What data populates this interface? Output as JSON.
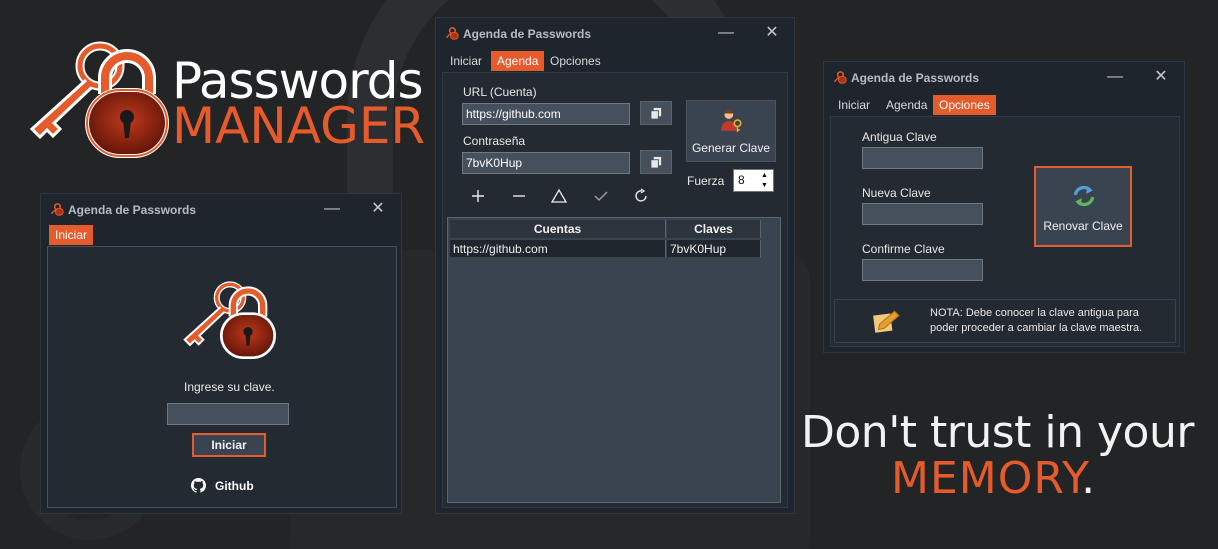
{
  "brand": {
    "line1": "Passwords",
    "line2": "MANAGER"
  },
  "tagline": {
    "line1": "Don't trust in your",
    "line2": "MEMORY",
    "line2_suffix": "."
  },
  "colors": {
    "accent": "#e55b2c",
    "background": "#222426",
    "window_bg": "#1e252c",
    "panel_bg": "#2b3440",
    "field_bg": "#46505c"
  },
  "window_title": "Agenda de Passwords",
  "window_buttons": {
    "minimize": "—",
    "close": "✕"
  },
  "login_window": {
    "tabs": [
      "Iniciar"
    ],
    "active_tab": "Iniciar",
    "prompt": "Ingrese su clave.",
    "password_value": "",
    "login_button": "Iniciar",
    "github_link": "Github",
    "icons": [
      "app-logo-icon",
      "github-icon"
    ]
  },
  "agenda_window": {
    "tabs": [
      "Iniciar",
      "Agenda",
      "Opciones"
    ],
    "active_tab": "Agenda",
    "url_label": "URL (Cuenta)",
    "url_value": "https://github.com",
    "password_label": "Contraseña",
    "password_value": "7bvK0Hup",
    "generate_button": "Generar Clave",
    "strength_label": "Fuerza",
    "strength_value": "8",
    "toolbar_icons": [
      "add-icon",
      "remove-icon",
      "triangle-icon",
      "check-icon",
      "refresh-icon"
    ],
    "table": {
      "columns": [
        "Cuentas",
        "Claves"
      ],
      "rows": [
        [
          "https://github.com",
          "7bvK0Hup"
        ]
      ]
    }
  },
  "options_window": {
    "tabs": [
      "Iniciar",
      "Agenda",
      "Opciones"
    ],
    "active_tab": "Opciones",
    "old_key_label": "Antigua Clave",
    "new_key_label": "Nueva Clave",
    "confirm_key_label": "Confirme Clave",
    "renew_button": "Renovar Clave",
    "note": "NOTA: Debe conocer la clave antigua para poder proceder a cambiar la clave maestra."
  }
}
